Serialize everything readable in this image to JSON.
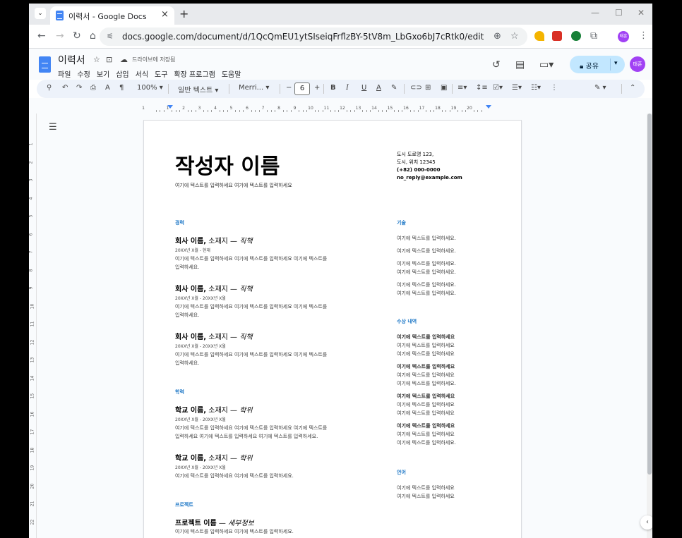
{
  "browser": {
    "tab_title": "이력서 - Google Docs",
    "tab_close": "×",
    "new_tab": "+",
    "url": "docs.google.com/document/d/1QcQmEU1ytSIseiqFrflzBY-5tV8m_LbGxo6bJ7cRtk0/edit",
    "profile_initials": "태훈",
    "minimize": "—",
    "maximize": "☐",
    "close": "✕"
  },
  "docs": {
    "title": "이력서",
    "save_status": "드라이브에 저장됨",
    "menu": [
      "파일",
      "수정",
      "보기",
      "삽입",
      "서식",
      "도구",
      "확장 프로그램",
      "도움말"
    ],
    "share_label": "공유",
    "user_initials": "태훈"
  },
  "toolbar": {
    "zoom": "100%",
    "style": "일반 텍스트",
    "font": "Merri...",
    "font_size": "6",
    "bold": "B",
    "italic": "I",
    "underline": "U",
    "text_color": "A"
  },
  "ruler": {
    "numbers": [
      "1",
      "1",
      "2",
      "3",
      "4",
      "5",
      "6",
      "7",
      "8",
      "9",
      "10",
      "11",
      "12",
      "13",
      "14",
      "15",
      "16",
      "17",
      "18",
      "19",
      "20"
    ],
    "vertical_numbers": [
      "1",
      "2",
      "3",
      "4",
      "5",
      "6",
      "7",
      "8",
      "9",
      "10",
      "11",
      "12",
      "13",
      "14",
      "15",
      "16",
      "17",
      "18",
      "19",
      "20",
      "21",
      "22"
    ]
  },
  "resume": {
    "name": "작성자 이름",
    "subtitle": "여기에 텍스트를 입력하세요 여기에 텍스트를 입력하세요",
    "contact": {
      "addr1": "도시 도로명 123,",
      "addr2": "도시, 위치 12345",
      "phone": "(+82) 000-0000",
      "email": "no_reply@example.com"
    },
    "sections": {
      "experience": "경력",
      "education": "학력",
      "projects": "프로젝트",
      "skills": "기술",
      "awards": "수상 내역",
      "languages": "언어"
    },
    "experience": [
      {
        "org": "회사 이름,",
        "place": " 소재지 — ",
        "role": "직책",
        "dates": "20XX년 X월 - 현재",
        "body1": "여기에 텍스트를 입력하세요 여기에 텍스트를 입력하세요 여기에 텍스트를",
        "body2": "입력하세요."
      },
      {
        "org": "회사 이름,",
        "place": " 소재지 — ",
        "role": "직책",
        "dates": "20XX년 X월 - 20XX년 X월",
        "body1": "여기에 텍스트를 입력하세요 여기에 텍스트를 입력하세요 여기에 텍스트를",
        "body2": "입력하세요."
      },
      {
        "org": "회사 이름,",
        "place": " 소재지 — ",
        "role": "직책",
        "dates": "20XX년 X월 - 20XX년 X월",
        "body1": "여기에 텍스트를 입력하세요 여기에 텍스트를 입력하세요 여기에 텍스트를",
        "body2": "입력하세요."
      }
    ],
    "education": [
      {
        "org": "학교 이름,",
        "place": " 소재지 — ",
        "role": "학위",
        "dates": "20XX년 X월 - 20XX년 X월",
        "body1": "여기에 텍스트를 입력하세요 여기에 텍스트를 입력하세요 여기에 텍스트를",
        "body2": "입력하세요 여기에 텍스트를 입력하세요 여기에 텍스트를 입력하세요."
      },
      {
        "org": "학교 이름,",
        "place": " 소재지 — ",
        "role": "학위",
        "dates": "20XX년 X월 - 20XX년 X월",
        "body1": "여기에 텍스트를 입력하세요 여기에 텍스트를 입력하세요."
      }
    ],
    "project": {
      "org": "프로젝트 이름",
      "place": " — ",
      "role": "세부정보",
      "body1": "여기에 텍스트를 입력하세요 여기에 텍스트를 입력하세요."
    },
    "skills": [
      "여기에 텍스트를 입력하세요.",
      "여기에 텍스트를 입력하세요.",
      "여기에 텍스트를 입력하세요.",
      "여기에 텍스트를 입력하세요.",
      "여기에 텍스트를 입력하세요.",
      "여기에 텍스트를 입력하세요."
    ],
    "awards": [
      [
        "여기에 텍스트를 입력하세요",
        "여기에 텍스트를 입력하세요",
        "여기에 텍스트를 입력하세요"
      ],
      [
        "여기에 텍스트를 입력하세요",
        "여기에 텍스트를 입력하세요",
        "여기에 텍스트를 입력하세요."
      ],
      [
        "여기에 텍스트를 입력하세요",
        "여기에 텍스트를 입력하세요",
        "여기에 텍스트를 입력하세요"
      ],
      [
        "여기에 텍스트를 입력하세요",
        "여기에 텍스트를 입력하세요",
        "여기에 텍스트를 입력하세요."
      ]
    ],
    "languages": [
      "여기에 텍스트를 입력하세요",
      "여기에 텍스트를 입력하세요"
    ]
  }
}
